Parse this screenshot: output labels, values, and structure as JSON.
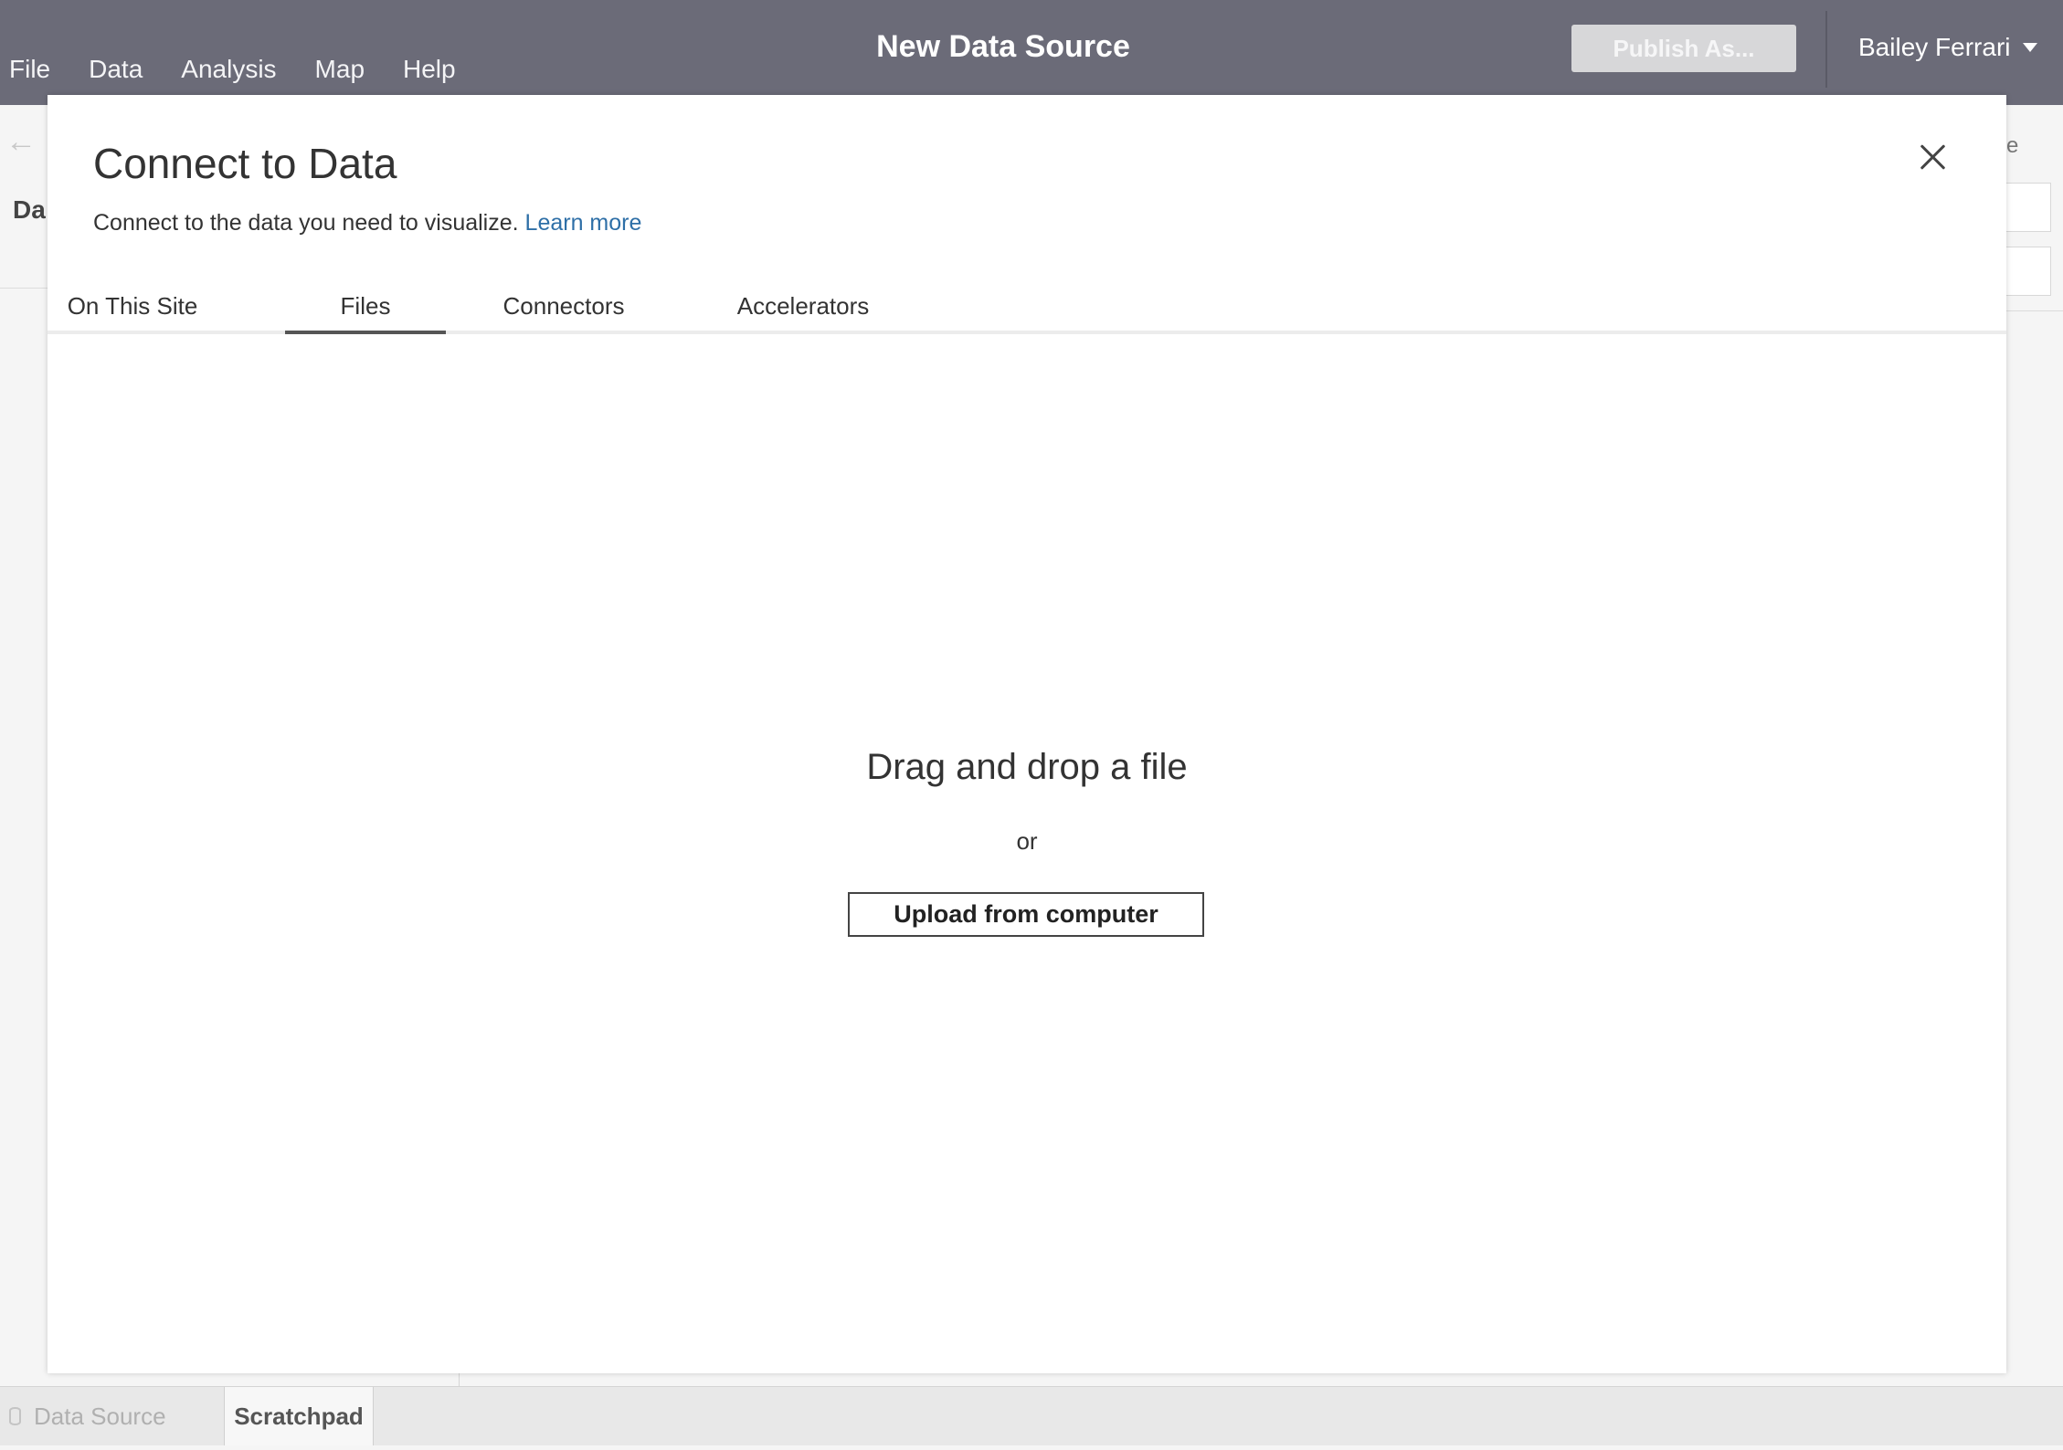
{
  "menu": {
    "items": [
      {
        "label": "File"
      },
      {
        "label": "Data"
      },
      {
        "label": "Analysis"
      },
      {
        "label": "Map"
      },
      {
        "label": "Help"
      }
    ]
  },
  "header": {
    "title": "New Data Source",
    "publish_label": "Publish As...",
    "user_name": "Bailey Ferrari"
  },
  "background": {
    "left_label": "Da",
    "right_label": "e"
  },
  "dialog": {
    "title": "Connect to Data",
    "subtitle": "Connect to the data you need to visualize.",
    "learn_more": "Learn more",
    "tabs": [
      {
        "label": "On This Site"
      },
      {
        "label": "Files",
        "active": true
      },
      {
        "label": "Connectors"
      },
      {
        "label": "Accelerators"
      }
    ],
    "drop_title": "Drag and drop a file",
    "or_text": "or",
    "upload_label": "Upload from computer"
  },
  "bottom_tabs": [
    {
      "label": "Data Source",
      "icon": "database-icon"
    },
    {
      "label": "Scratchpad",
      "active": true
    }
  ],
  "colors": {
    "topbar": "#6b6b78",
    "link": "#2e6fa7",
    "active_tab_underline": "#555555"
  }
}
